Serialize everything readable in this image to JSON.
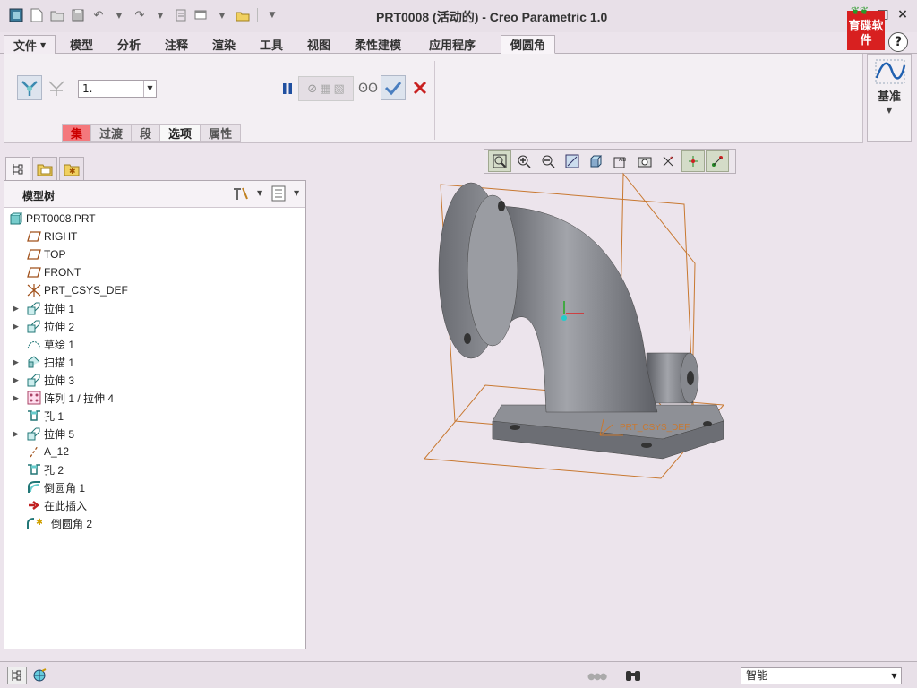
{
  "titlebar": {
    "title": "PRT0008 (活动的) - Creo Parametric 1.0",
    "logo_text": "育碟软件",
    "help": "?"
  },
  "menu": {
    "file": "文件",
    "tabs": [
      "模型",
      "分析",
      "注释",
      "渲染",
      "工具",
      "视图",
      "柔性建模",
      "应用程序"
    ],
    "active_tab": "倒圆角"
  },
  "ribbon": {
    "radius_value": "1.",
    "subtabs": [
      "集",
      "过渡",
      "段",
      "选项",
      "属性"
    ],
    "selected_subtab": "选项",
    "datum_label": "基准"
  },
  "tree": {
    "header": "模型树",
    "root": "PRT0008.PRT",
    "items": [
      {
        "label": "RIGHT",
        "icon": "datum-plane-icon",
        "expandable": false
      },
      {
        "label": "TOP",
        "icon": "datum-plane-icon",
        "expandable": false
      },
      {
        "label": "FRONT",
        "icon": "datum-plane-icon",
        "expandable": false
      },
      {
        "label": "PRT_CSYS_DEF",
        "icon": "csys-icon",
        "expandable": false
      },
      {
        "label": "拉伸 1",
        "icon": "extrude-icon",
        "expandable": true
      },
      {
        "label": "拉伸 2",
        "icon": "extrude-icon",
        "expandable": true
      },
      {
        "label": "草绘 1",
        "icon": "sketch-icon",
        "expandable": false
      },
      {
        "label": "扫描 1",
        "icon": "sweep-icon",
        "expandable": true
      },
      {
        "label": "拉伸 3",
        "icon": "extrude-icon",
        "expandable": true
      },
      {
        "label": "阵列 1 / 拉伸 4",
        "icon": "pattern-icon",
        "expandable": true
      },
      {
        "label": "孔 1",
        "icon": "hole-icon",
        "expandable": false
      },
      {
        "label": "拉伸 5",
        "icon": "extrude-icon",
        "expandable": true
      },
      {
        "label": "A_12",
        "icon": "axis-icon",
        "expandable": false
      },
      {
        "label": "孔 2",
        "icon": "hole-icon",
        "expandable": false
      },
      {
        "label": "倒圆角 1",
        "icon": "round-icon",
        "expandable": false
      },
      {
        "label": "在此插入",
        "icon": "insert-arrow-icon",
        "expandable": false
      },
      {
        "label": "倒圆角 2",
        "icon": "round-new-icon",
        "expandable": false
      }
    ]
  },
  "viewport": {
    "csys_label": "PRT_CSYS_DEF"
  },
  "status": {
    "filter_value": "智能"
  },
  "colors": {
    "background": "#ece4ec",
    "part_gray": "#8a8c92",
    "datum_orange": "#c87830",
    "accept_blue": "#4a7fc0",
    "cancel_red": "#c82020"
  }
}
